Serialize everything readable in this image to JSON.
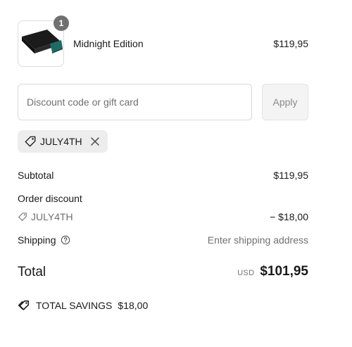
{
  "product": {
    "name": "Midnight Edition",
    "price": "$119,95",
    "quantity": "1",
    "image": "wallet-product-image"
  },
  "discount": {
    "placeholder": "Discount code or gift card",
    "value": "",
    "apply_label": "Apply",
    "applied_code": "JULY4TH"
  },
  "summary": {
    "subtotal_label": "Subtotal",
    "subtotal_value": "$119,95",
    "order_discount_label": "Order discount",
    "discount_code": "JULY4TH",
    "discount_value": "− $18,00",
    "shipping_label": "Shipping",
    "shipping_value": "Enter shipping address",
    "total_label": "Total",
    "currency": "USD",
    "total_value": "$101,95",
    "savings_label": "TOTAL SAVINGS",
    "savings_value": "$18,00"
  },
  "colors": {
    "text": "#1a1a1a",
    "muted": "#707070",
    "badge": "#707070",
    "chip_bg": "#ededed",
    "border": "#d9d9d9"
  }
}
